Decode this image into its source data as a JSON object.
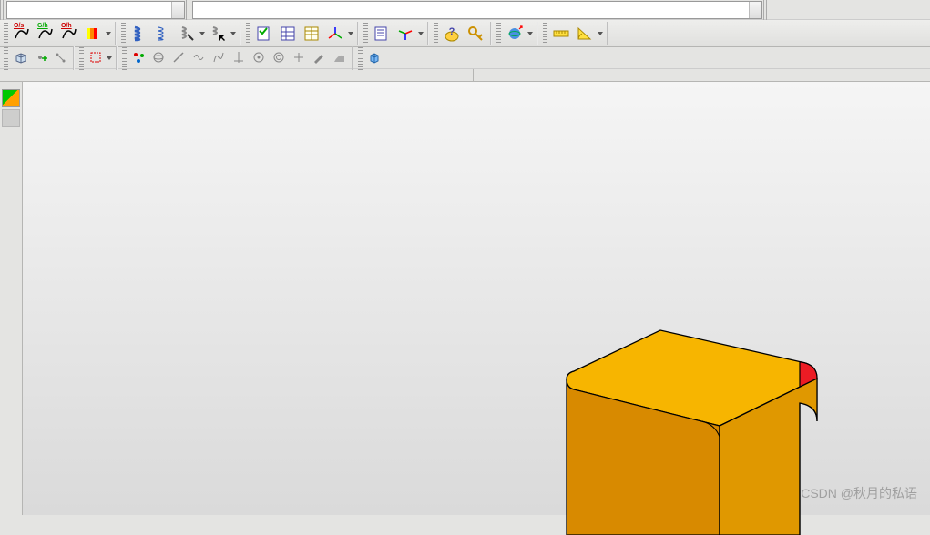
{
  "combos": {
    "c1_value": "",
    "c2_value": ""
  },
  "toolbar1": {
    "btns": [
      "os-curve",
      "gh-curve",
      "oh-curve",
      "paint-strip",
      "spring-solid",
      "spring-outline",
      "spring-tool",
      "spring-select",
      "check-list",
      "spreadsheet",
      "props-grid",
      "axis-arrows",
      "list-toggle",
      "tri-axis",
      "q-mark",
      "key-tool",
      "sphere-tool",
      "ruler",
      "angle-tool"
    ],
    "labels": {
      "os": "O/s",
      "gh": "G/h",
      "oh": "O/h"
    }
  },
  "toolbar2": {
    "btns": [
      "box-iso",
      "add-center",
      "conn-line",
      "select-rect",
      "atoms",
      "orbit-ball",
      "pencil",
      "wave-line",
      "curve-s",
      "vert-axis",
      "circle-dot",
      "circle-ring",
      "plus",
      "pencil2",
      "wedge",
      "cube-blue"
    ]
  },
  "side": {
    "thumbs": [
      "model-thumb",
      "part-thumb"
    ]
  },
  "watermark": "CSDN @秋月的私语",
  "model": {
    "top_color": "#f7b500",
    "front_color": "#d88a00",
    "side_color": "#e09800",
    "fillet_color": "#ec1c24",
    "edge_color": "#000000"
  }
}
